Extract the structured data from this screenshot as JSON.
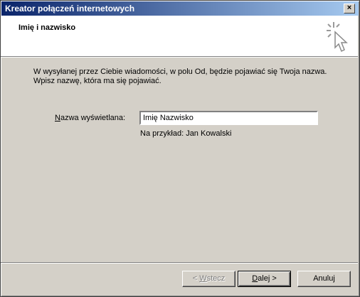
{
  "window": {
    "title": "Kreator połączeń internetowych",
    "close_label": "×"
  },
  "header": {
    "title": "Imię i nazwisko",
    "icon": "wizard-sparkle-cursor-icon"
  },
  "content": {
    "description_line1": "W wysyłanej przez Ciebie wiadomości, w polu Od, będzie pojawiać się Twoja nazwa.",
    "description_line2": "Wpisz nazwę, która ma się pojawiać.",
    "field_label_accel": "N",
    "field_label_rest": "azwa wyświetlana:",
    "field_value": "Imię Nazwisko",
    "example": "Na przykład: Jan Kowalski"
  },
  "buttons": {
    "back_prefix": "< ",
    "back_accel": "W",
    "back_rest": "stecz",
    "next_accel": "D",
    "next_rest": "alej >",
    "cancel": "Anuluj"
  }
}
